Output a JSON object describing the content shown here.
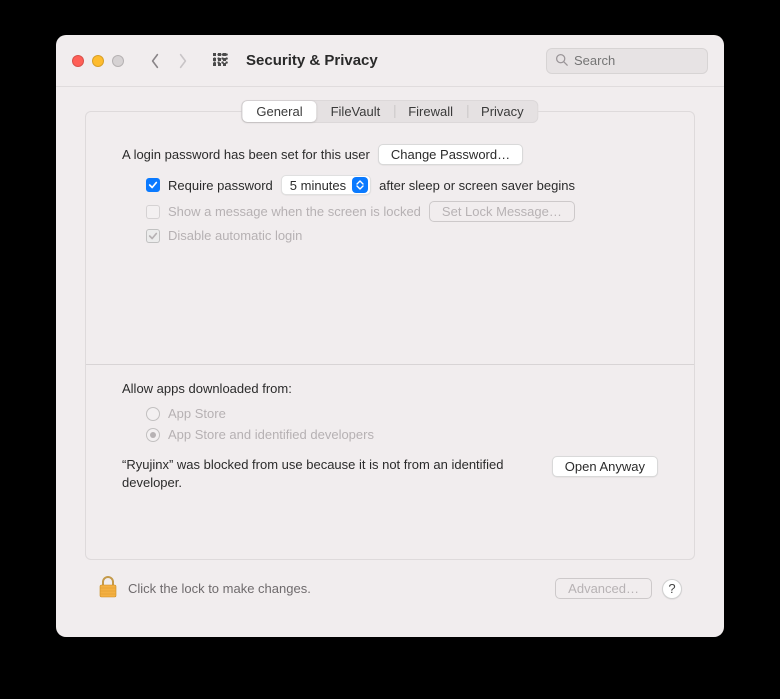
{
  "header": {
    "title": "Security & Privacy",
    "search_placeholder": "Search"
  },
  "tabs": [
    "General",
    "FileVault",
    "Firewall",
    "Privacy"
  ],
  "active_tab": 0,
  "login": {
    "heading": "A login password has been set for this user",
    "change_password_btn": "Change Password…",
    "require_password_label_pre": "Require password",
    "require_password_value": "5 minutes",
    "require_password_label_post": "after sleep or screen saver begins",
    "show_message_label": "Show a message when the screen is locked",
    "set_lock_message_btn": "Set Lock Message…",
    "disable_auto_login_label": "Disable automatic login"
  },
  "allow": {
    "heading": "Allow apps downloaded from:",
    "option_a": "App Store",
    "option_b": "App Store and identified developers",
    "blocked_text": "“Ryujinx” was blocked from use because it is not from an identified developer.",
    "open_anyway_btn": "Open Anyway"
  },
  "footer": {
    "lock_text": "Click the lock to make changes.",
    "advanced_btn": "Advanced…"
  }
}
